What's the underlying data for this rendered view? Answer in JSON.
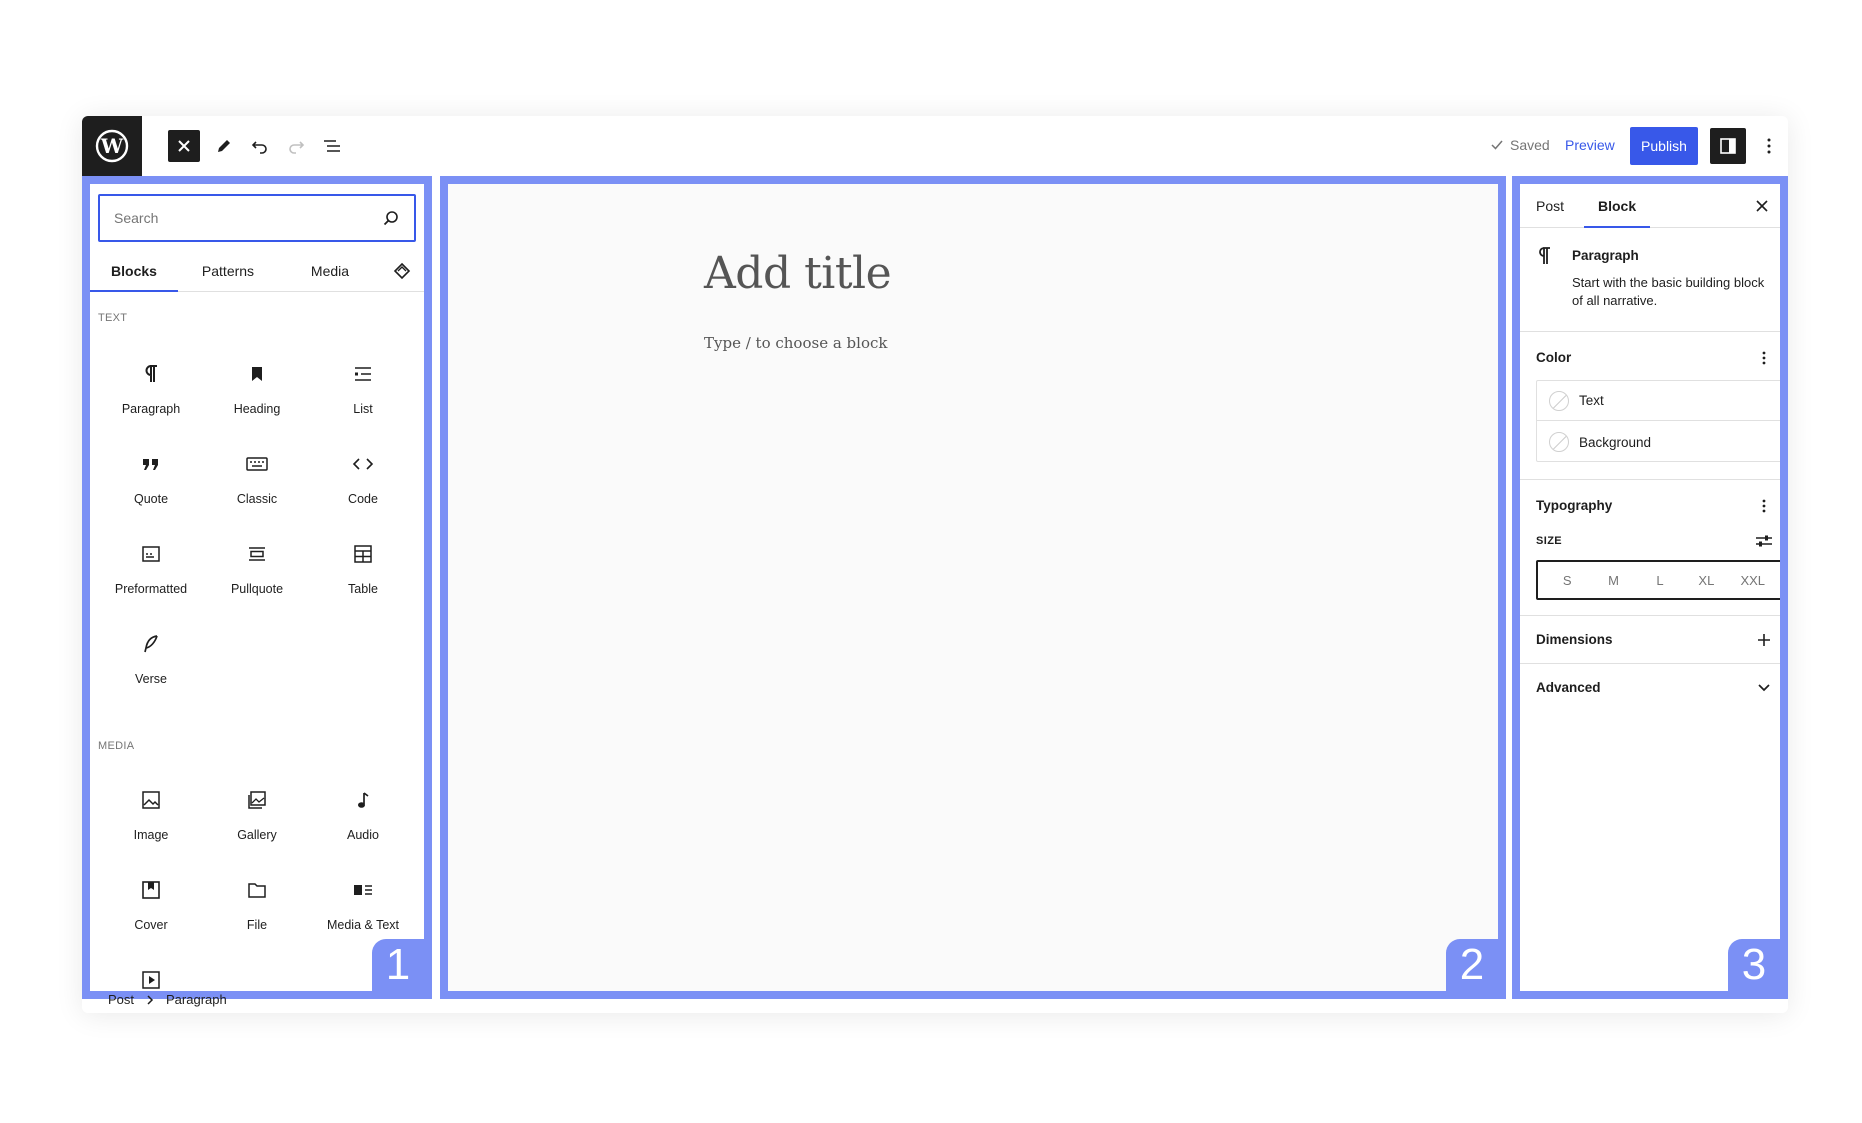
{
  "toolbar": {
    "saved_label": "Saved",
    "preview_label": "Preview",
    "publish_label": "Publish"
  },
  "inserter": {
    "search_placeholder": "Search",
    "tabs": [
      "Blocks",
      "Patterns",
      "Media"
    ],
    "sections": [
      {
        "label": "TEXT",
        "blocks": [
          {
            "label": "Paragraph",
            "icon": "paragraph-icon"
          },
          {
            "label": "Heading",
            "icon": "heading-icon"
          },
          {
            "label": "List",
            "icon": "list-icon"
          },
          {
            "label": "Quote",
            "icon": "quote-icon"
          },
          {
            "label": "Classic",
            "icon": "classic-keyboard-icon"
          },
          {
            "label": "Code",
            "icon": "code-icon"
          },
          {
            "label": "Preformatted",
            "icon": "preformatted-icon"
          },
          {
            "label": "Pullquote",
            "icon": "pullquote-icon"
          },
          {
            "label": "Table",
            "icon": "table-icon"
          },
          {
            "label": "Verse",
            "icon": "verse-quill-icon"
          }
        ]
      },
      {
        "label": "MEDIA",
        "blocks": [
          {
            "label": "Image",
            "icon": "image-icon"
          },
          {
            "label": "Gallery",
            "icon": "gallery-icon"
          },
          {
            "label": "Audio",
            "icon": "audio-icon"
          },
          {
            "label": "Cover",
            "icon": "cover-icon"
          },
          {
            "label": "File",
            "icon": "file-folder-icon"
          },
          {
            "label": "Media & Text",
            "icon": "media-text-icon"
          }
        ]
      }
    ]
  },
  "canvas": {
    "title_placeholder": "Add title",
    "block_hint": "Type / to choose a block"
  },
  "sidebar": {
    "tabs": [
      "Post",
      "Block"
    ],
    "block_card": {
      "title": "Paragraph",
      "description": "Start with the basic building block of all narrative."
    },
    "color": {
      "heading": "Color",
      "items": [
        "Text",
        "Background"
      ]
    },
    "typography": {
      "heading": "Typography",
      "size_label": "SIZE",
      "sizes": [
        "S",
        "M",
        "L",
        "XL",
        "XXL"
      ]
    },
    "dimensions": {
      "heading": "Dimensions"
    },
    "advanced": {
      "heading": "Advanced"
    }
  },
  "breadcrumb": {
    "items": [
      "Post",
      "Paragraph"
    ]
  },
  "badges": [
    "1",
    "2",
    "3"
  ],
  "colors": {
    "accent": "#3858e9",
    "highlight": "#7b90f5",
    "dark": "#1e1e1e"
  }
}
